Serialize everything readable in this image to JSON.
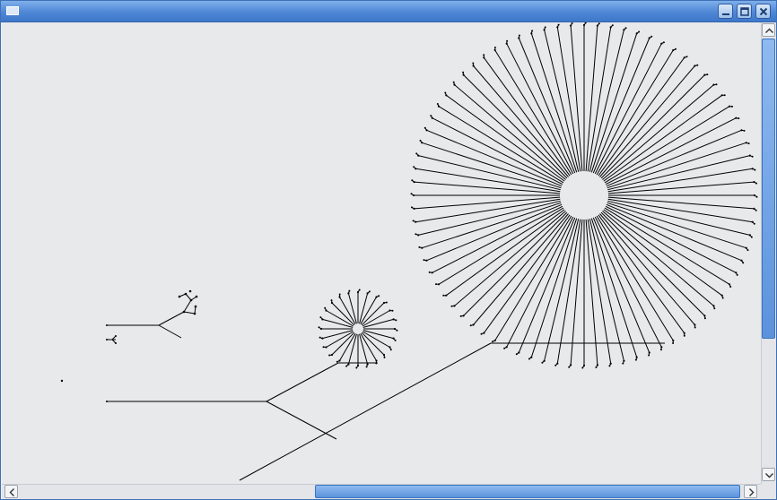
{
  "window": {
    "title": "",
    "icons": {
      "system": "window-icon",
      "minimize": "minimize-icon",
      "maximize": "maximize-icon",
      "close": "close-icon"
    }
  },
  "scrollbars": {
    "vertical": {
      "position": 0.0,
      "visible_fraction": 0.7,
      "up_icon": "arrow-up-icon",
      "down_icon": "arrow-down-icon"
    },
    "horizontal": {
      "position": 1.0,
      "visible_fraction": 0.59,
      "left_icon": "arrow-left-icon",
      "right_icon": "arrow-right-icon"
    }
  },
  "drawing": {
    "stroke_color": "#000000",
    "background_color": "#e8e9eb",
    "large_radial_tree_spokes": 80,
    "small_radial_tree_spokes": 24
  }
}
